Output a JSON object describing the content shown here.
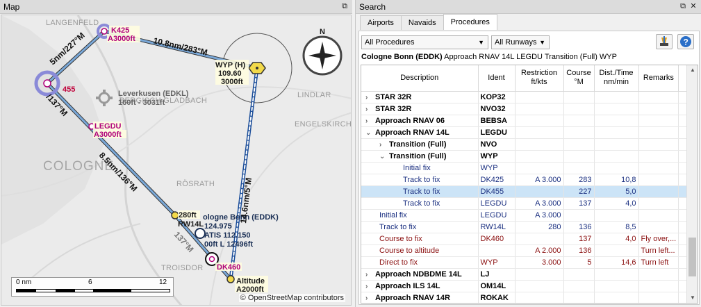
{
  "map": {
    "title": "Map",
    "float_icon": "float-window-icon",
    "attribution": "© OpenStreetMap contributors",
    "places": {
      "langenfeld": "LANGENFELD",
      "bergisch": "BERGISCH GLADBACH",
      "cologne": "COLOGNE",
      "engelskirchen": "ENGELSKIRCHE",
      "rosrath": "RÖSRATH",
      "lindlar": "LINDLAR",
      "troisdorf": "TROISDOR"
    },
    "airport_leverkusen": {
      "name": "Leverkusen (EDKL)",
      "elev": "160ft - 3031ft"
    },
    "fixes": {
      "dk425": {
        "name": "K425",
        "alt": "A3000ft"
      },
      "dk455": {
        "name": "455"
      },
      "legdu": {
        "name": "LEGDU",
        "alt": "A3000ft"
      },
      "wyp": {
        "name": "WYP (H)",
        "freq": "109.60",
        "alt": "3000ft"
      },
      "rw14l": {
        "alt": "280ft",
        "name": "RW14L"
      },
      "dk460": {
        "name": "DK460"
      },
      "altitude": {
        "name": "Altitude",
        "alt": "A2000ft"
      }
    },
    "airport_cologne": {
      "name": "ologne Bonn (EDDK)",
      "runway": "124.975",
      "atis": "ATIS 112.150",
      "rwy_info": "00ft L 12496ft"
    },
    "legs": {
      "l1": "5nm/227°M",
      "l2": "10.8nm/283°M",
      "l3": "/137°M",
      "l4": "8.5nm/136°M",
      "l5": "14.6nm/5°M",
      "l6": "137°M"
    },
    "compass_n": "N",
    "scale": {
      "a": "0 nm",
      "b": "6",
      "c": "12"
    }
  },
  "search": {
    "title": "Search",
    "tabs": [
      "Airports",
      "Navaids",
      "Procedures"
    ],
    "active_tab": 2,
    "filter_procedures": "All Procedures",
    "filter_runways": "All Runways",
    "header_airport": "Cologne Bonn (EDDK)",
    "header_proc": " Approach RNAV 14L LEGDU Transition (Full) WYP",
    "columns": [
      "Description",
      "Ident",
      "Restriction ft/kts",
      "Course °M",
      "Dist./Time nm/min",
      "Remarks"
    ],
    "rows": [
      {
        "indent": 0,
        "exp": "right",
        "style": "lvl0",
        "desc": "STAR 32R",
        "ident": "KOP32",
        "restr": "",
        "course": "",
        "dist": "",
        "rem": ""
      },
      {
        "indent": 0,
        "exp": "right",
        "style": "lvl0",
        "desc": "STAR 32R",
        "ident": "NVO32",
        "restr": "",
        "course": "",
        "dist": "",
        "rem": ""
      },
      {
        "indent": 0,
        "exp": "right",
        "style": "lvl0",
        "desc": "Approach RNAV 06",
        "ident": "BEBSA",
        "restr": "",
        "course": "",
        "dist": "",
        "rem": ""
      },
      {
        "indent": 0,
        "exp": "down",
        "style": "lvl0",
        "desc": "Approach RNAV 14L",
        "ident": "LEGDU",
        "restr": "",
        "course": "",
        "dist": "",
        "rem": ""
      },
      {
        "indent": 1,
        "exp": "right",
        "style": "lvl1",
        "desc": "Transition (Full)",
        "ident": "NVO",
        "restr": "",
        "course": "",
        "dist": "",
        "rem": ""
      },
      {
        "indent": 1,
        "exp": "down",
        "style": "lvl1",
        "desc": "Transition (Full)",
        "ident": "WYP",
        "restr": "",
        "course": "",
        "dist": "",
        "rem": ""
      },
      {
        "indent": 2,
        "exp": "",
        "style": "navy",
        "desc": "Initial fix",
        "ident": "WYP",
        "restr": "",
        "course": "",
        "dist": "",
        "rem": ""
      },
      {
        "indent": 2,
        "exp": "",
        "style": "navy",
        "desc": "Track to fix",
        "ident": "DK425",
        "restr": "A 3.000",
        "course": "283",
        "dist": "10,8",
        "rem": ""
      },
      {
        "indent": 2,
        "exp": "",
        "style": "navy",
        "desc": "Track to fix",
        "ident": "DK455",
        "restr": "",
        "course": "227",
        "dist": "5,0",
        "rem": "",
        "selected": true
      },
      {
        "indent": 2,
        "exp": "",
        "style": "navy",
        "desc": "Track to fix",
        "ident": "LEGDU",
        "restr": "A 3.000",
        "course": "137",
        "dist": "4,0",
        "rem": ""
      },
      {
        "indent": 1,
        "exp": "",
        "style": "navy",
        "desc": "Initial fix",
        "ident": "LEGDU",
        "restr": "A 3.000",
        "course": "",
        "dist": "",
        "rem": ""
      },
      {
        "indent": 1,
        "exp": "",
        "style": "navy",
        "desc": "Track to fix",
        "ident": "RW14L",
        "restr": "280",
        "course": "136",
        "dist": "8,5",
        "rem": ""
      },
      {
        "indent": 1,
        "exp": "",
        "style": "red",
        "desc": "Course to fix",
        "ident": "DK460",
        "restr": "",
        "course": "137",
        "dist": "4,0",
        "rem": "Fly over,..."
      },
      {
        "indent": 1,
        "exp": "",
        "style": "red",
        "desc": "Course to altitude",
        "ident": "",
        "restr": "A 2.000",
        "course": "136",
        "dist": "",
        "rem": "Turn left..."
      },
      {
        "indent": 1,
        "exp": "",
        "style": "red",
        "desc": "Direct to fix",
        "ident": "WYP",
        "restr": "3.000",
        "course": "5",
        "dist": "14,6",
        "rem": "Turn left"
      },
      {
        "indent": 0,
        "exp": "right",
        "style": "lvl0",
        "desc": "Approach NDBDME 14L",
        "ident": "LJ",
        "restr": "",
        "course": "",
        "dist": "",
        "rem": ""
      },
      {
        "indent": 0,
        "exp": "right",
        "style": "lvl0",
        "desc": "Approach ILS 14L",
        "ident": "OM14L",
        "restr": "",
        "course": "",
        "dist": "",
        "rem": ""
      },
      {
        "indent": 0,
        "exp": "right",
        "style": "lvl0",
        "desc": "Approach RNAV 14R",
        "ident": "ROKAK",
        "restr": "",
        "course": "",
        "dist": "",
        "rem": ""
      }
    ]
  }
}
